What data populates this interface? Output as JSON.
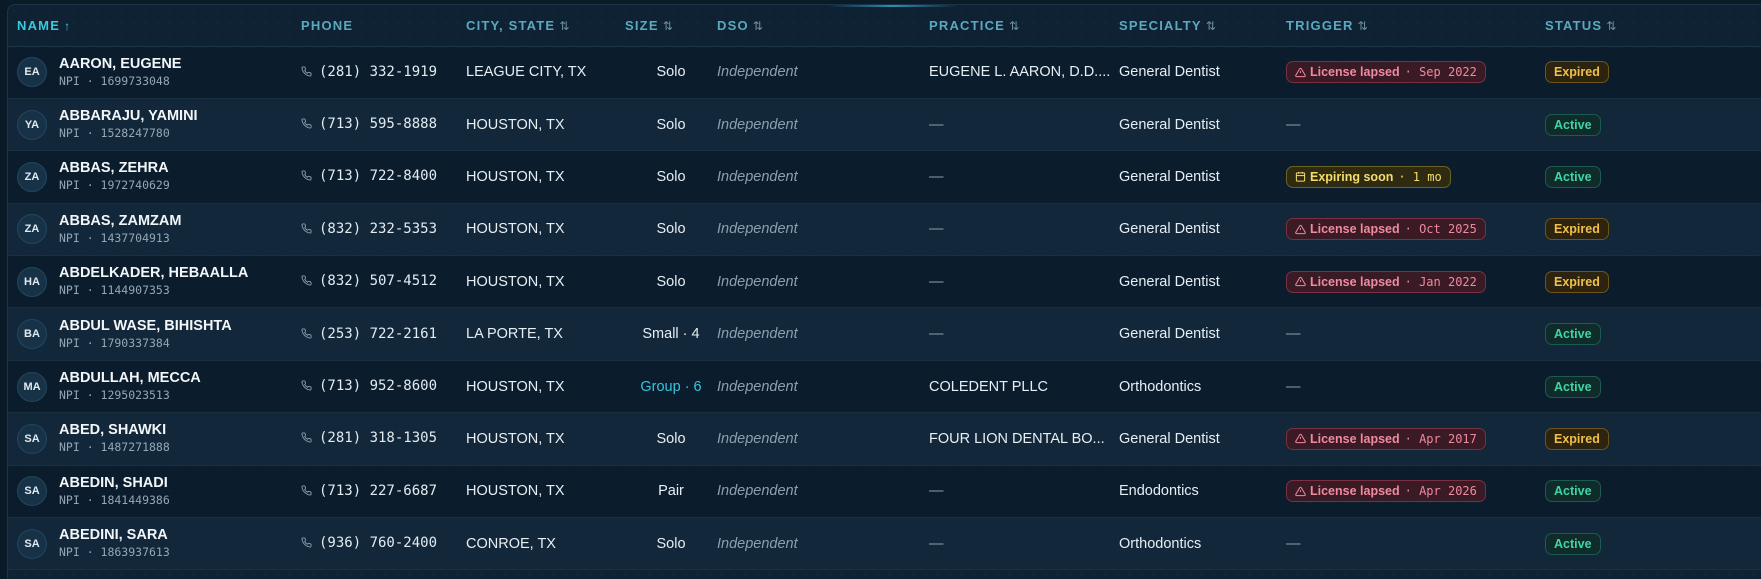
{
  "columns": [
    {
      "label": "NAME",
      "sort": "↑",
      "active": true
    },
    {
      "label": "PHONE",
      "sort": "",
      "active": false
    },
    {
      "label": "CITY, STATE",
      "sort": "⇅",
      "active": false
    },
    {
      "label": "SIZE",
      "sort": "⇅",
      "active": false
    },
    {
      "label": "DSO",
      "sort": "⇅",
      "active": false
    },
    {
      "label": "PRACTICE",
      "sort": "⇅",
      "active": false
    },
    {
      "label": "SPECIALTY",
      "sort": "⇅",
      "active": false
    },
    {
      "label": "TRIGGER",
      "sort": "⇅",
      "active": false
    },
    {
      "label": "STATUS",
      "sort": "⇅",
      "active": false
    }
  ],
  "colors": {
    "accent": "#39c9e0",
    "expired": "#f1c04a",
    "active": "#3fd5a5",
    "lapsed": "#f08aa0",
    "expiring": "#f3dc6a"
  },
  "rows": [
    {
      "initials": "EA",
      "name": "AARON, EUGENE",
      "npi": "NPI · 1699733048",
      "phone": "(281) 332-1919",
      "city": "LEAGUE CITY, TX",
      "size": "Solo",
      "size_group": false,
      "dso": "Independent",
      "practice": "EUGENE L. AARON, D.D....",
      "specialty": "General Dentist",
      "trigger": {
        "type": "lapsed",
        "label": "License lapsed",
        "detail": "· Sep 2022",
        "icon": "warning-icon"
      },
      "status": "Expired"
    },
    {
      "initials": "YA",
      "name": "ABBARAJU, YAMINI",
      "npi": "NPI · 1528247780",
      "phone": "(713) 595-8888",
      "city": "HOUSTON, TX",
      "size": "Solo",
      "size_group": false,
      "dso": "Independent",
      "practice": "—",
      "specialty": "General Dentist",
      "trigger": null,
      "status": "Active"
    },
    {
      "initials": "ZA",
      "name": "ABBAS, ZEHRA",
      "npi": "NPI · 1972740629",
      "phone": "(713) 722-8400",
      "city": "HOUSTON, TX",
      "size": "Solo",
      "size_group": false,
      "dso": "Independent",
      "practice": "—",
      "specialty": "General Dentist",
      "trigger": {
        "type": "soon",
        "label": "Expiring soon",
        "detail": "· 1 mo",
        "icon": "calendar-icon"
      },
      "status": "Active"
    },
    {
      "initials": "ZA",
      "name": "ABBAS, ZAMZAM",
      "npi": "NPI · 1437704913",
      "phone": "(832) 232-5353",
      "city": "HOUSTON, TX",
      "size": "Solo",
      "size_group": false,
      "dso": "Independent",
      "practice": "—",
      "specialty": "General Dentist",
      "trigger": {
        "type": "lapsed",
        "label": "License lapsed",
        "detail": "· Oct 2025",
        "icon": "warning-icon"
      },
      "status": "Expired"
    },
    {
      "initials": "HA",
      "name": "ABDELKADER, HEBAALLA",
      "npi": "NPI · 1144907353",
      "phone": "(832) 507-4512",
      "city": "HOUSTON, TX",
      "size": "Solo",
      "size_group": false,
      "dso": "Independent",
      "practice": "—",
      "specialty": "General Dentist",
      "trigger": {
        "type": "lapsed",
        "label": "License lapsed",
        "detail": "· Jan 2022",
        "icon": "warning-icon"
      },
      "status": "Expired"
    },
    {
      "initials": "BA",
      "name": "ABDUL WASE, BIHISHTA",
      "npi": "NPI · 1790337384",
      "phone": "(253) 722-2161",
      "city": "LA PORTE, TX",
      "size": "Small · 4",
      "size_group": false,
      "dso": "Independent",
      "practice": "—",
      "specialty": "General Dentist",
      "trigger": null,
      "status": "Active"
    },
    {
      "initials": "MA",
      "name": "ABDULLAH, MECCA",
      "npi": "NPI · 1295023513",
      "phone": "(713) 952-8600",
      "city": "HOUSTON, TX",
      "size": "Group · 6",
      "size_group": true,
      "dso": "Independent",
      "practice": "COLEDENT PLLC",
      "specialty": "Orthodontics",
      "trigger": null,
      "status": "Active"
    },
    {
      "initials": "SA",
      "name": "ABED, SHAWKI",
      "npi": "NPI · 1487271888",
      "phone": "(281) 318-1305",
      "city": "HOUSTON, TX",
      "size": "Solo",
      "size_group": false,
      "dso": "Independent",
      "practice": "FOUR LION DENTAL BO...",
      "specialty": "General Dentist",
      "trigger": {
        "type": "lapsed",
        "label": "License lapsed",
        "detail": "· Apr 2017",
        "icon": "warning-icon"
      },
      "status": "Expired"
    },
    {
      "initials": "SA",
      "name": "ABEDIN, SHADI",
      "npi": "NPI · 1841449386",
      "phone": "(713) 227-6687",
      "city": "HOUSTON, TX",
      "size": "Pair",
      "size_group": false,
      "dso": "Independent",
      "practice": "—",
      "specialty": "Endodontics",
      "trigger": {
        "type": "lapsed",
        "label": "License lapsed",
        "detail": "· Apr 2026",
        "icon": "warning-icon"
      },
      "status": "Active"
    },
    {
      "initials": "SA",
      "name": "ABEDINI, SARA",
      "npi": "NPI · 1863937613",
      "phone": "(936) 760-2400",
      "city": "CONROE, TX",
      "size": "Solo",
      "size_group": false,
      "dso": "Independent",
      "practice": "—",
      "specialty": "Orthodontics",
      "trigger": null,
      "status": "Active"
    }
  ]
}
